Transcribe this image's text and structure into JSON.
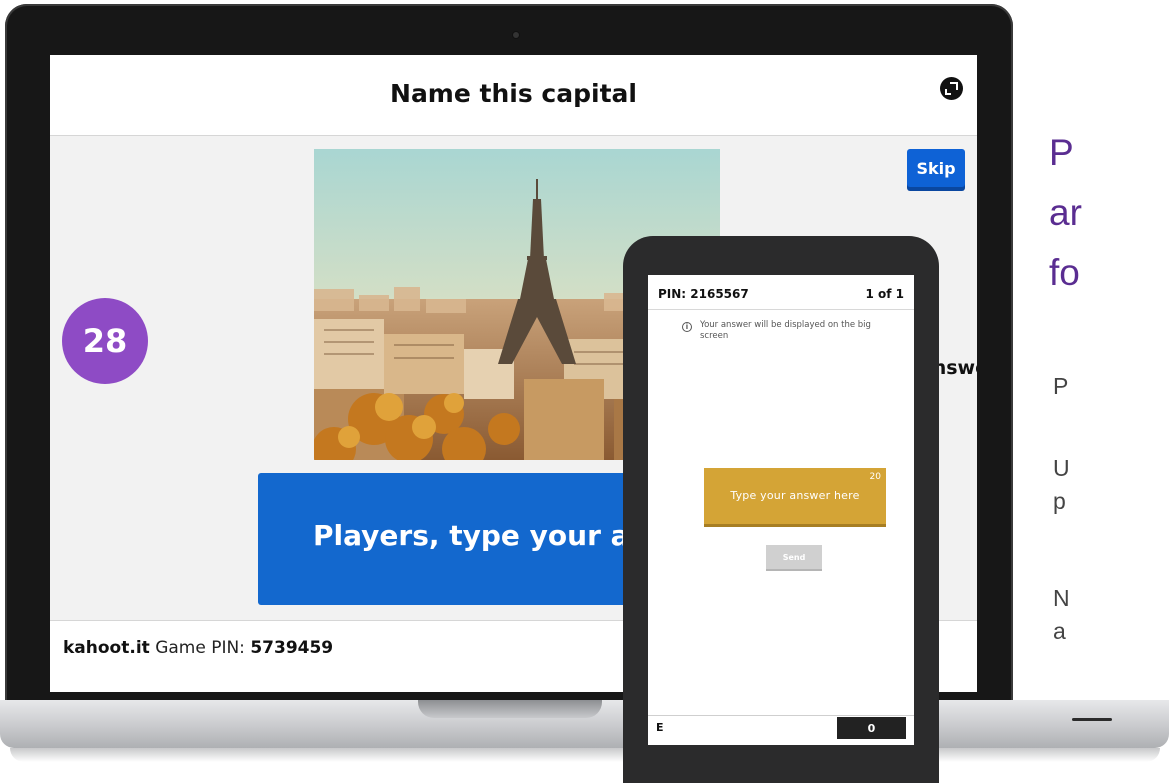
{
  "laptop": {
    "question_title": "Name this capital",
    "skip_label": "Skip",
    "timer_value": "28",
    "answers_label": "Answers",
    "prompt_text": "Players, type your answers",
    "footer": {
      "site": "kahoot.it",
      "game_pin_label": "Game PIN:",
      "game_pin": "5739459"
    },
    "image_alt": "Eiffel Tower over Paris"
  },
  "phone": {
    "pin_text": "PIN: 2165567",
    "question_count": "1 of 1",
    "info_text": "Your answer will be displayed on the big screen",
    "answer_placeholder": "Type your answer here",
    "char_limit": "20",
    "send_label": "Send",
    "player_name": "E",
    "score": "0"
  },
  "side_panel": {
    "heading_lines": [
      "P",
      "ar",
      "fo"
    ],
    "text_lines": [
      [
        "P"
      ],
      [
        "U",
        "p"
      ],
      [
        "N",
        "a"
      ]
    ]
  },
  "colors": {
    "timer_purple": "#8e4bc5",
    "kahoot_blue": "#1368ce",
    "answer_gold": "#d4a436",
    "heading_purple": "#5a2d91"
  }
}
